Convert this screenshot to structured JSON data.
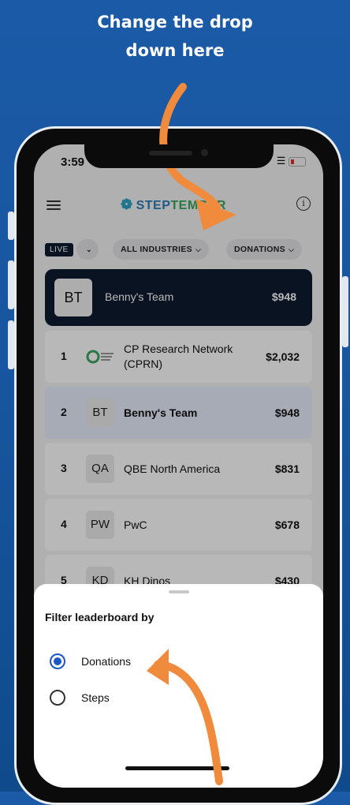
{
  "caption": {
    "line1": "Change the drop",
    "line2": "down here"
  },
  "status": {
    "time": "3:59"
  },
  "app": {
    "logo_text_a": "STEP",
    "logo_text_b": "TEMBER"
  },
  "filters": {
    "live": "LIVE",
    "scope_chevron": "⌄",
    "industries": "ALL INDUSTRIES",
    "metric": "DONATIONS"
  },
  "hero": {
    "badge": "BT",
    "name": "Benny's Team",
    "amount": "$948"
  },
  "rows": [
    {
      "rank": "1",
      "badge": "",
      "name": "CP Research Network (CPRN)",
      "amount": "$2,032"
    },
    {
      "rank": "2",
      "badge": "BT",
      "name": "Benny's Team",
      "amount": "$948"
    },
    {
      "rank": "3",
      "badge": "QA",
      "name": "QBE North America",
      "amount": "$831"
    },
    {
      "rank": "4",
      "badge": "PW",
      "name": "PwC",
      "amount": "$678"
    },
    {
      "rank": "5",
      "badge": "KD",
      "name": "KH Dinos",
      "amount": "$430"
    }
  ],
  "sheet": {
    "title": "Filter leaderboard by",
    "options": [
      {
        "label": "Donations",
        "selected": true
      },
      {
        "label": "Steps",
        "selected": false
      }
    ]
  },
  "colors": {
    "background": "#1b5aa6",
    "arrow": "#f08a3c",
    "accent": "#1a56c4",
    "hero": "#0d1b2e"
  }
}
